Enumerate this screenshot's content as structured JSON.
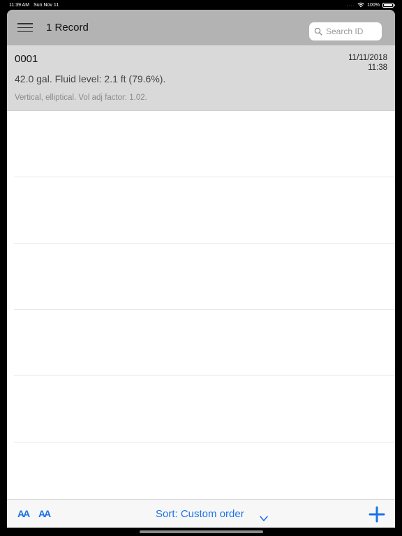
{
  "status_bar": {
    "time": "11:39 AM",
    "date": "Sun Nov 11",
    "signal": "....",
    "battery_percent": "100%"
  },
  "navbar": {
    "record_count": "1 Record",
    "search_placeholder": "Search ID"
  },
  "records": [
    {
      "id": "0001",
      "date": "11/11/2018",
      "time": "11:38",
      "summary": "42.0 gal. Fluid level: 2.1 ft (79.6%).",
      "detail": "Vertical, elliptical. Vol adj factor: 1.02."
    }
  ],
  "toolbar": {
    "font_small_label": "AA",
    "font_large_label": "AA",
    "sort_label": "Sort: Custom order"
  },
  "colors": {
    "accent": "#1a73e8",
    "navbar_bg": "#b3b3b3",
    "selected_row_bg": "#d9d9d9"
  }
}
